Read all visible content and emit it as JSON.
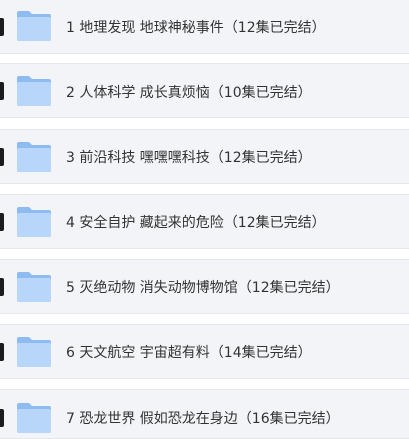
{
  "folders": [
    {
      "label": "1 地理发现 地球神秘事件（12集已完结）",
      "icon": "folder-icon"
    },
    {
      "label": "2 人体科学 成长真烦恼（10集已完结）",
      "icon": "folder-icon"
    },
    {
      "label": "3 前沿科技 嘿嘿嘿科技（12集已完结）",
      "icon": "folder-icon"
    },
    {
      "label": "4 安全自护 藏起来的危险（12集已完结）",
      "icon": "folder-icon"
    },
    {
      "label": "5 灭绝动物 消失动物博物馆（12集已完结）",
      "icon": "folder-icon"
    },
    {
      "label": "6 天文航空 宇宙超有料（14集已完结）",
      "icon": "folder-icon"
    },
    {
      "label": "7 恐龙世界 假如恐龙在身边（16集已完结）",
      "icon": "folder-icon"
    }
  ],
  "colors": {
    "row_background": "#f3f4f7",
    "folder_back": "#8fbcf0",
    "folder_front": "#b7d6fa",
    "text": "#333333",
    "marker": "#1c1c1c"
  }
}
